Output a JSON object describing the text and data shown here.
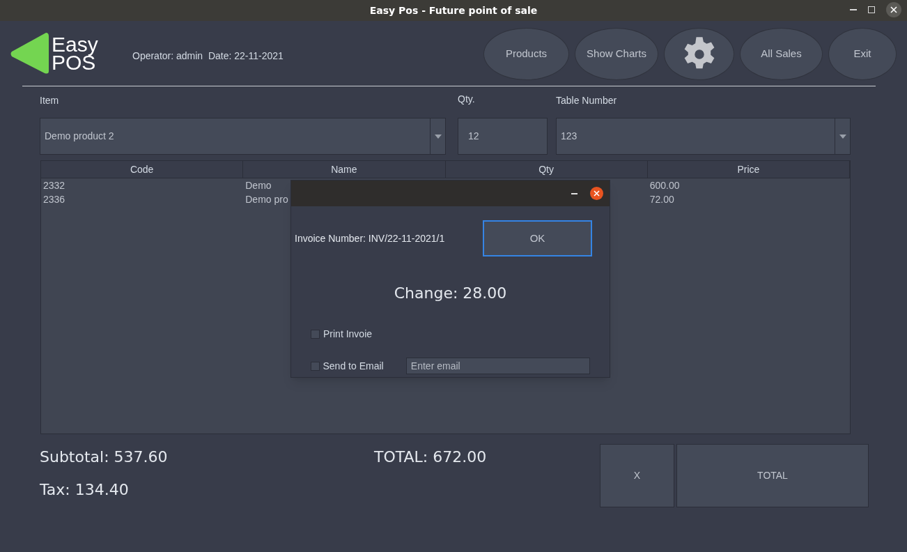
{
  "window": {
    "title": "Easy Pos - Future point of sale"
  },
  "logo": {
    "line1": "Easy",
    "line2": "POS"
  },
  "session": {
    "text": "Operator: admin  Date: 22-11-2021"
  },
  "nav_buttons": [
    {
      "kind": "text",
      "label": "Products"
    },
    {
      "kind": "text",
      "label": "Show Charts"
    },
    {
      "kind": "settings"
    },
    {
      "kind": "text",
      "label": "All Sales"
    },
    {
      "kind": "text",
      "label": "Exit"
    }
  ],
  "form": {
    "item_label": "Item",
    "item_value": "Demo product 2",
    "qty_label": "Qty.",
    "qty_value": "12",
    "table_label": "Table Number",
    "table_value": "123"
  },
  "table": {
    "columns": [
      "Code",
      "Name",
      "Qty",
      "Price"
    ],
    "rows": [
      [
        "2332",
        "Demo",
        "",
        "600.00"
      ],
      [
        "2336",
        "Demo pro",
        "",
        "72.00"
      ]
    ]
  },
  "totals": {
    "subtotal": "Subtotal: 537.60",
    "tax": "Tax: 134.40",
    "total": "TOTAL: 672.00"
  },
  "actions": {
    "clear": "X",
    "total": "TOTAL"
  },
  "dialog": {
    "invoice": "Invoice Number: INV/22-11-2021/1",
    "ok": "OK",
    "change": "Change: 28.00",
    "options": [
      {
        "label": "Print Invoie",
        "checked": false
      },
      {
        "label": "Send to Email",
        "checked": false
      }
    ],
    "email_placeholder": "Enter email"
  }
}
